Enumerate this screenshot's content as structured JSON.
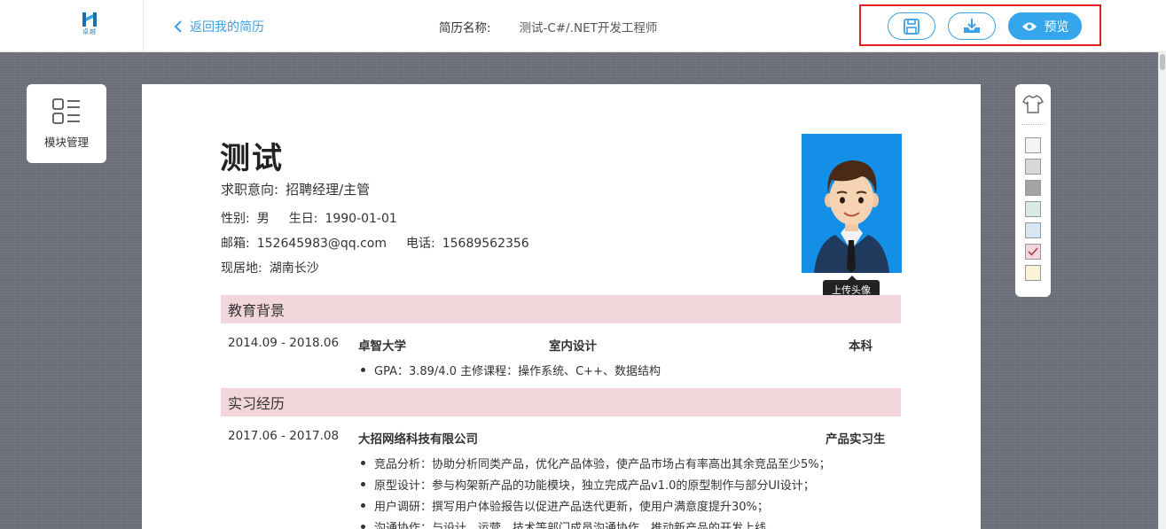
{
  "header": {
    "logo_text": "卓越",
    "back_label": "返回我的简历",
    "resume_name_label": "简历名称:",
    "resume_name_value": "测试-C#/.NET开发工程师",
    "preview_label": "预览"
  },
  "left_panel": {
    "module_label": "模块管理"
  },
  "colors": {
    "accent": "#35a5ec",
    "section_bg": "#f2d6db",
    "highlight_border": "#e02020",
    "swatches": [
      "#f4f4f4",
      "#d8d8d8",
      "#a3a3a3",
      "#d9eae3",
      "#d6e6f2",
      "#f2d6db",
      "#fcf2d5"
    ],
    "selected_swatch_index": 5
  },
  "resume": {
    "name": "测试",
    "intention_label": "求职意向:",
    "intention_value": "招聘经理/主管",
    "gender_label": "性别:",
    "gender_value": "男",
    "birth_label": "生日:",
    "birth_value": "1990-01-01",
    "email_label": "邮箱:",
    "email_value": "152645983@qq.com",
    "phone_label": "电话:",
    "phone_value": "15689562356",
    "location_label": "现居地:",
    "location_value": "湖南长沙",
    "upload_avatar": "上传头像",
    "education": {
      "title": "教育背景",
      "period": "2014.09 - 2018.06",
      "school": "卓智大学",
      "major": "室内设计",
      "degree": "本科",
      "bullets": [
        "GPA：3.89/4.0 主修课程：操作系统、C++、数据结构"
      ]
    },
    "internship": {
      "title": "实习经历",
      "period": "2017.06 - 2017.08",
      "company": "大招网络科技有限公司",
      "role": "产品实习生",
      "bullets": [
        "竞品分析：协助分析同类产品，优化产品体验，使产品市场占有率高出其余竞品至少5%；",
        "原型设计：参与构架新产品的功能模块，独立完成产品v1.0的原型制作与部分UI设计；",
        "用户调研：撰写用户体验报告以促进产品迭代更新，使用户满意度提升30%；",
        "沟通协作：与设计、运营、技术等部门成员沟通协作，推动新产品的开发上线。"
      ]
    }
  }
}
